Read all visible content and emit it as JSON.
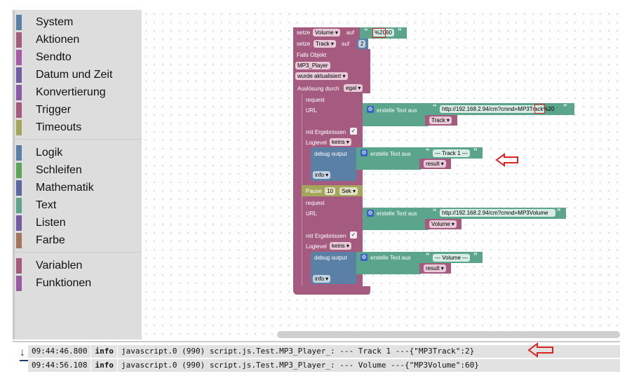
{
  "sidebar": {
    "groups": [
      [
        {
          "label": "System",
          "color": "#5b80a5"
        },
        {
          "label": "Aktionen",
          "color": "#a55b80"
        },
        {
          "label": "Sendto",
          "color": "#a55ba5"
        },
        {
          "label": "Datum und Zeit",
          "color": "#745ba5"
        },
        {
          "label": "Konvertierung",
          "color": "#8c5ba5"
        },
        {
          "label": "Trigger",
          "color": "#a55b80"
        },
        {
          "label": "Timeouts",
          "color": "#a5a55b"
        }
      ],
      [
        {
          "label": "Logik",
          "color": "#5b80a5"
        },
        {
          "label": "Schleifen",
          "color": "#5ba55b"
        },
        {
          "label": "Mathematik",
          "color": "#5b67a5"
        },
        {
          "label": "Text",
          "color": "#5ba58c"
        },
        {
          "label": "Listen",
          "color": "#745ba5"
        },
        {
          "label": "Farbe",
          "color": "#a5745b"
        }
      ],
      [
        {
          "label": "Variablen",
          "color": "#a55b80"
        },
        {
          "label": "Funktionen",
          "color": "#995ba5"
        }
      ]
    ]
  },
  "blocks": {
    "set1": {
      "setze": "setze",
      "var": "Volume",
      "auf": "auf",
      "value": "%2060"
    },
    "set2": {
      "setze": "setze",
      "var": "Track",
      "auf": "auf",
      "value": "2"
    },
    "trigger": {
      "falls": "Falls Objekt",
      "object": "MP3_Player",
      "event": "wurde aktualisiert",
      "ausl": "Auslösung durch",
      "ausl_val": "egal"
    },
    "req1": {
      "title": "request",
      "url": "URL",
      "join": "erstelle Text aus",
      "text": "http://192.168.2.94/cm?cmnd=MP3Track%20",
      "var": "Track",
      "mit": "mit Ergebnissen",
      "loglevel": "Loglevel",
      "loglevel_val": "keins"
    },
    "dbg1": {
      "title": "debug output",
      "join": "erstelle Text aus",
      "text": "--- Track 1 ---",
      "var": "result",
      "level": "info"
    },
    "pause": {
      "label": "Pause",
      "value": "10",
      "unit": "Sek"
    },
    "req2": {
      "title": "request",
      "url": "URL",
      "join": "erstelle Text aus",
      "text": "http://192.168.2.94/cm?cmnd=MP3Volume",
      "var": "Volume",
      "mit": "mit Ergebnissen",
      "loglevel": "Loglevel",
      "loglevel_val": "keins"
    },
    "dbg2": {
      "title": "debug output",
      "join": "erstelle Text aus",
      "text": "--- Volume ---",
      "var": "result",
      "level": "info"
    }
  },
  "log": {
    "rows": [
      {
        "time": "09:44:46.800",
        "level": "info",
        "msg": "javascript.0 (990) script.js.Test.MP3_Player_: --- Track 1 ---{\"MP3Track\":2}"
      },
      {
        "time": "09:44:56.108",
        "level": "info",
        "msg": "javascript.0 (990) script.js.Test.MP3_Player_: --- Volume ---{\"MP3Volume\":60}"
      }
    ]
  },
  "colors": {
    "actions": "#a55b80",
    "text": "#5ba58c",
    "debug": "#5b80a5",
    "timeouts": "#a5a55b",
    "annotation": "#d22222"
  }
}
